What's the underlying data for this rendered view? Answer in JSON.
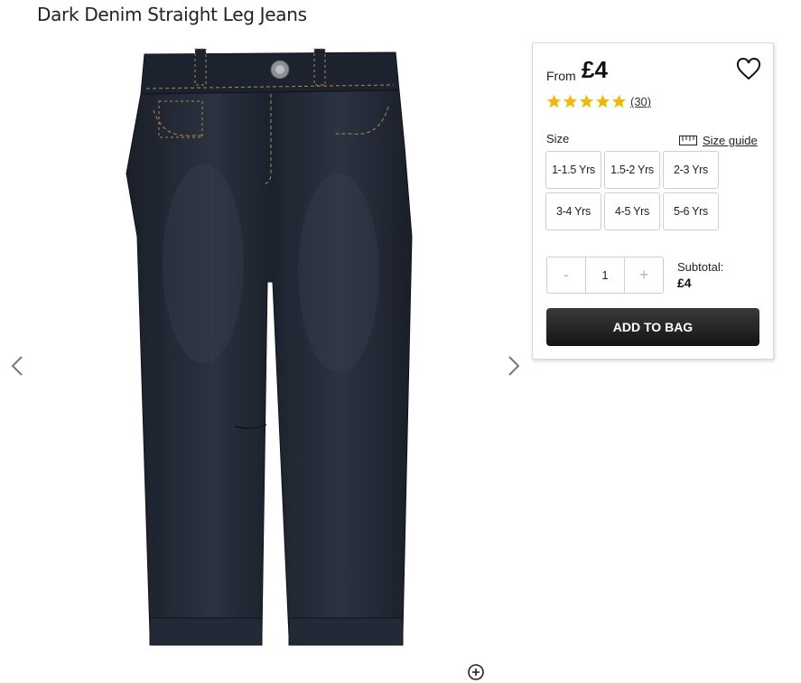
{
  "product": {
    "title": "Dark Denim Straight Leg Jeans"
  },
  "purchase": {
    "from_label": "From",
    "price": "£4",
    "rating": 5,
    "review_count": "(30)",
    "size_label": "Size",
    "size_guide": "Size guide",
    "sizes": [
      "1-1.5 Yrs",
      "1.5-2 Yrs",
      "2-3 Yrs",
      "3-4 Yrs",
      "4-5 Yrs",
      "5-6 Yrs"
    ],
    "qty_minus": "-",
    "qty_value": "1",
    "qty_plus": "+",
    "subtotal_label": "Subtotal:",
    "subtotal_value": "£4",
    "add_to_bag": "ADD TO BAG"
  },
  "colors": {
    "star": "#f5b800",
    "button": "#222222",
    "denim": "#1f2531"
  },
  "icons": {
    "prev": "chevron-left-icon",
    "next": "chevron-right-icon",
    "wishlist": "heart-icon",
    "size_guide": "ruler-icon",
    "zoom": "zoom-icon"
  }
}
